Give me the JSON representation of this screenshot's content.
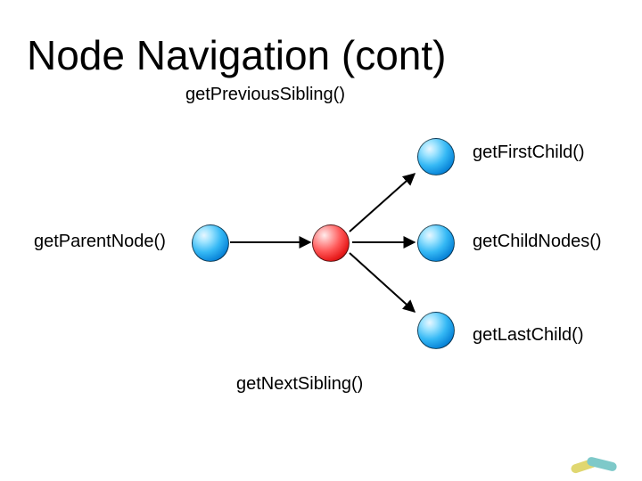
{
  "title": "Node Navigation (cont)",
  "labels": {
    "prevSibling": "getPreviousSibling()",
    "firstChild": "getFirstChild()",
    "parentNode": "getParentNode()",
    "childNodes": "getChildNodes()",
    "lastChild": "getLastChild()",
    "nextSibling": "getNextSibling()"
  },
  "chart_data": {
    "type": "diagram",
    "title": "Node Navigation (cont)",
    "nodes": [
      {
        "id": "parent",
        "color": "blue",
        "label": "getParentNode()"
      },
      {
        "id": "current",
        "color": "red",
        "label": ""
      },
      {
        "id": "firstChild",
        "color": "blue",
        "label": "getFirstChild()"
      },
      {
        "id": "child",
        "color": "blue",
        "label": "getChildNodes()"
      },
      {
        "id": "lastChild",
        "color": "blue",
        "label": "getLastChild()"
      }
    ],
    "edges": [
      {
        "from": "parent",
        "to": "current"
      },
      {
        "from": "current",
        "to": "firstChild"
      },
      {
        "from": "current",
        "to": "child"
      },
      {
        "from": "current",
        "to": "lastChild"
      }
    ],
    "annotations": [
      {
        "text": "getPreviousSibling()",
        "near": "top"
      },
      {
        "text": "getNextSibling()",
        "near": "bottom"
      }
    ]
  }
}
